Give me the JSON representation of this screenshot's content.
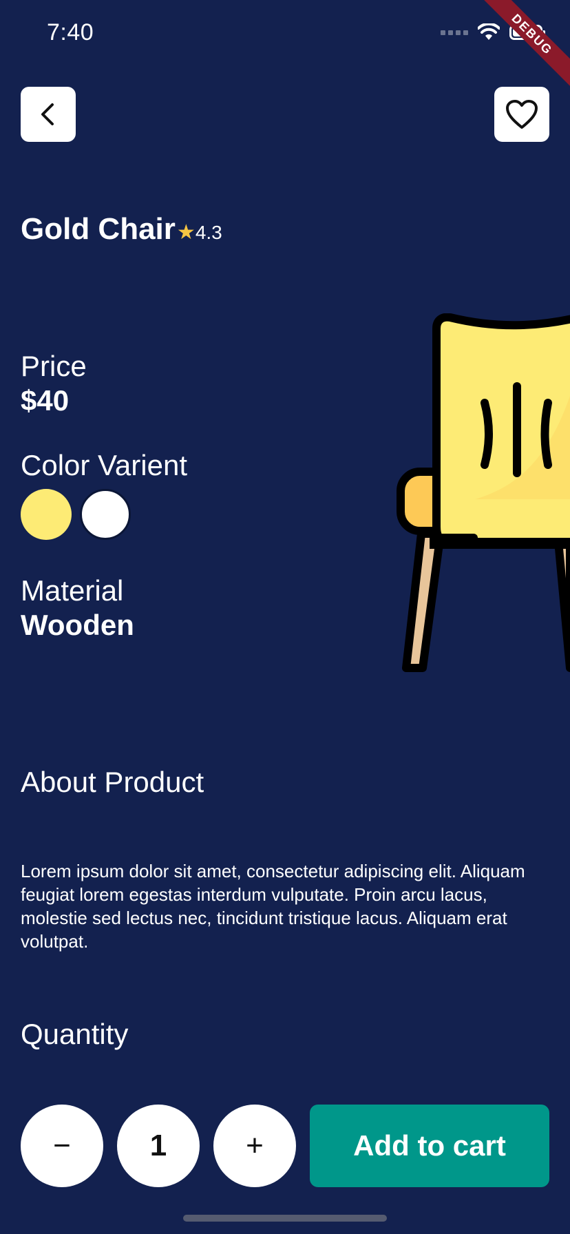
{
  "status_bar": {
    "time": "7:40"
  },
  "debug_banner": "DEBUG",
  "product": {
    "name": "Gold Chair",
    "rating": "4.3",
    "price_label": "Price",
    "price": "$40",
    "color_label": "Color Varient",
    "colors": [
      "#fdeb75",
      "#ffffff"
    ],
    "material_label": "Material",
    "material": "Wooden"
  },
  "about": {
    "title": "About Product",
    "text": "Lorem ipsum dolor sit amet, consectetur adipiscing elit. Aliquam feugiat lorem egestas interdum vulputate. Proin arcu lacus, molestie sed lectus nec, tincidunt tristique lacus. Aliquam erat volutpat."
  },
  "quantity": {
    "title": "Quantity",
    "value": "1",
    "minus_symbol": "−",
    "plus_symbol": "+"
  },
  "actions": {
    "add_to_cart": "Add to cart"
  },
  "colors": {
    "background": "#13214f",
    "accent": "#00978a"
  },
  "icons": [
    "back-arrow-icon",
    "heart-icon",
    "star-icon",
    "wifi-icon",
    "battery-icon",
    "signal-icon"
  ]
}
